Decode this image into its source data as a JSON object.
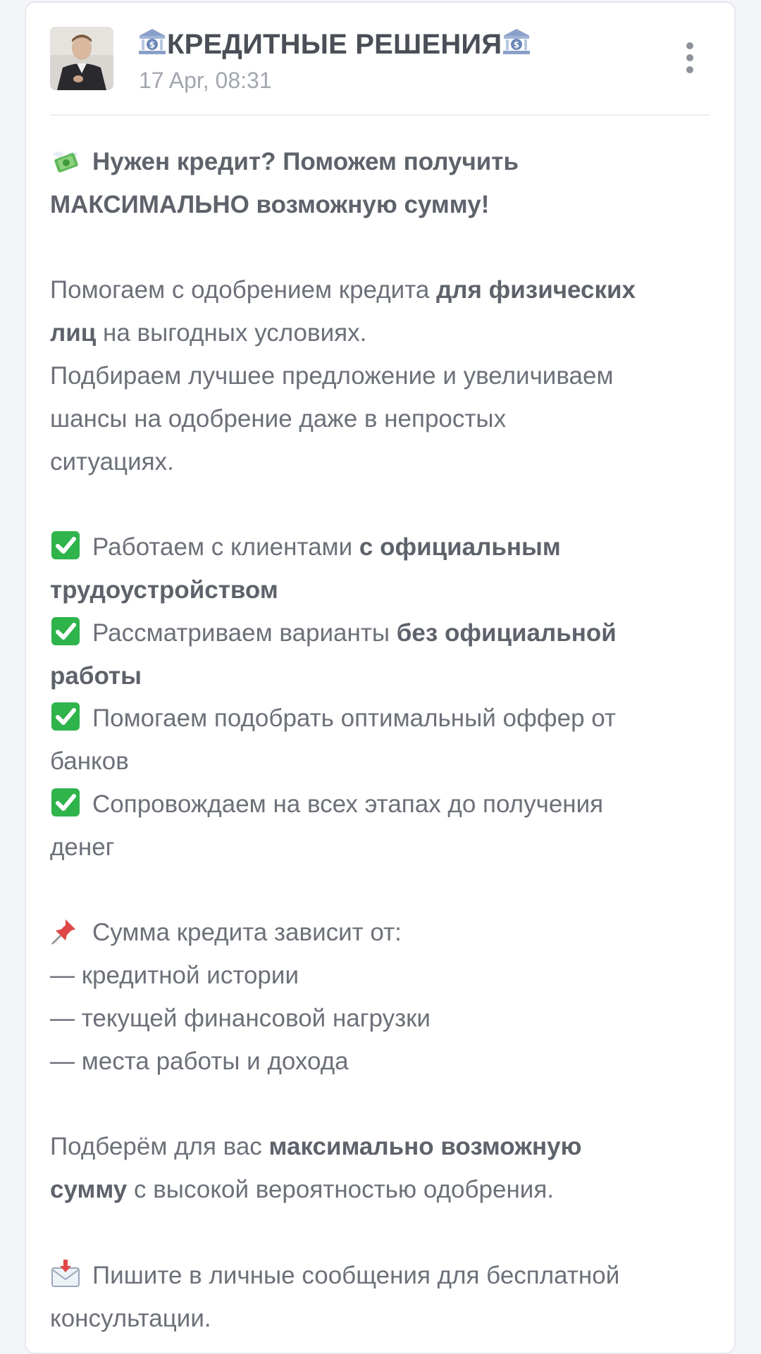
{
  "post": {
    "channel_title": "КРЕДИТНЫЕ РЕШЕНИЯ",
    "date": "17 Apr, 08:31"
  },
  "body": {
    "l1a": "Нужен кредит? Поможем получить",
    "l1b": "МАКСИМАЛЬНО возможную сумму!",
    "l2a": "Помогаем с одобрением кредита ",
    "l2b": "для физических",
    "l3a": "лиц",
    "l3b": " на выгодных условиях.",
    "l4": "Подбираем лучшее предложение и увеличиваем",
    "l5": "шансы на одобрение даже в непростых",
    "l6": "ситуациях.",
    "c1a": "Работаем с клиентами ",
    "c1b": "с официальным",
    "c1c": "трудоустройством",
    "c2a": "Рассматриваем варианты ",
    "c2b": "без официальной",
    "c2c": "работы",
    "c3a": "Помогаем подобрать оптимальный оффер от",
    "c3b": "банков",
    "c4a": "Сопровождаем на всех этапах до получения",
    "c4b": "денег",
    "p1": "Сумма кредита зависит от:",
    "p2": "— кредитной истории",
    "p3": "— текущей финансовой нагрузки",
    "p4": "— места работы и дохода",
    "s1a": "Подберём для вас ",
    "s1b": "максимально возможную",
    "s2a": "сумму",
    "s2b": " с высокой вероятностью одобрения.",
    "m1": "Пишите в личные сообщения для бесплатной",
    "m2": "консультации."
  },
  "icons": {
    "bank": "bank-emoji",
    "money": "money-with-wings-emoji",
    "check": "check-mark-button-emoji",
    "pin": "pushpin-emoji",
    "envelope": "envelope-with-arrow-emoji",
    "menu": "vertical-ellipsis-icon"
  },
  "colors": {
    "text": "#6c7079",
    "title": "#4a4e57",
    "muted": "#a2a6ae",
    "check_green": "#2fb34b"
  }
}
